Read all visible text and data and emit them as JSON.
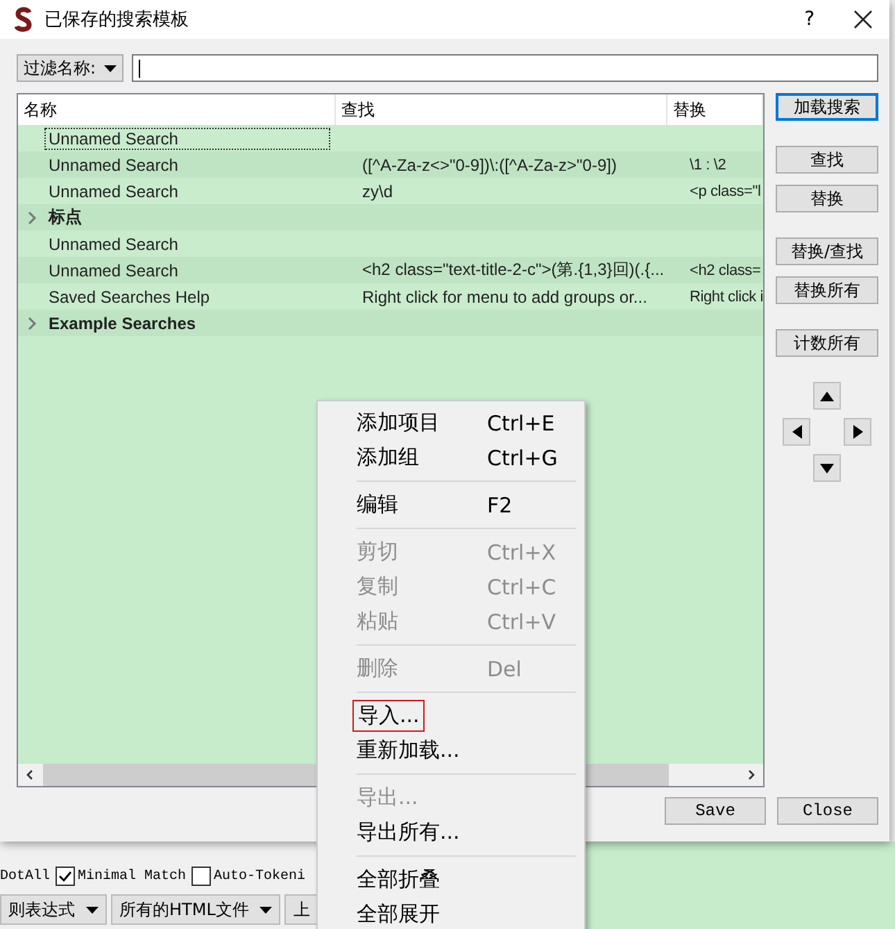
{
  "window": {
    "title": "已保存的搜索模板",
    "help": "?"
  },
  "filter": {
    "label": "过滤名称:"
  },
  "table": {
    "columns": [
      "名称",
      "查找",
      "替换"
    ],
    "rows": [
      {
        "kind": "item",
        "name": "Unnamed Search",
        "find": "",
        "replace": "",
        "focused": true
      },
      {
        "kind": "item",
        "name": "Unnamed Search",
        "find": "([^A-Za-z<>\"0-9])\\:([^A-Za-z>\"0-9])",
        "replace": "\\1 : \\2",
        "focused": false
      },
      {
        "kind": "item",
        "name": "Unnamed Search",
        "find": "zy\\d",
        "replace": "<p class=\"l",
        "focused": false
      },
      {
        "kind": "group",
        "name": "标点",
        "expanded": false
      },
      {
        "kind": "item",
        "name": "Unnamed Search",
        "find": "",
        "replace": "",
        "focused": false
      },
      {
        "kind": "item",
        "name": "Unnamed Search",
        "find": "<h2 class=\"text-title-2-c\">(第.{1,3}回)(.{...",
        "replace": "<h2 class=",
        "focused": false
      },
      {
        "kind": "item",
        "name": "Saved Searches Help",
        "find": "Right click for menu to add groups or...",
        "replace": "Right click i",
        "focused": false
      },
      {
        "kind": "group",
        "name": "Example Searches",
        "expanded": false
      }
    ]
  },
  "side_buttons": [
    [
      {
        "label": "加载搜索",
        "default": true
      }
    ],
    [
      {
        "label": "查找",
        "default": false
      },
      {
        "label": "替换",
        "default": false
      }
    ],
    [
      {
        "label": "替换/查找",
        "default": false
      },
      {
        "label": "替换所有",
        "default": false
      }
    ],
    [
      {
        "label": "计数所有",
        "default": false
      }
    ]
  ],
  "footer_buttons": [
    "Save",
    "Close"
  ],
  "context_menu": [
    {
      "kind": "item",
      "label": "添加项目",
      "shortcut": "Ctrl+E",
      "disabled": false,
      "marked": false
    },
    {
      "kind": "item",
      "label": "添加组",
      "shortcut": "Ctrl+G",
      "disabled": false,
      "marked": false
    },
    {
      "kind": "separator"
    },
    {
      "kind": "item",
      "label": "编辑",
      "shortcut": "F2",
      "disabled": false,
      "marked": false
    },
    {
      "kind": "separator"
    },
    {
      "kind": "item",
      "label": "剪切",
      "shortcut": "Ctrl+X",
      "disabled": true,
      "marked": false
    },
    {
      "kind": "item",
      "label": "复制",
      "shortcut": "Ctrl+C",
      "disabled": true,
      "marked": false
    },
    {
      "kind": "item",
      "label": "粘贴",
      "shortcut": "Ctrl+V",
      "disabled": true,
      "marked": false
    },
    {
      "kind": "separator"
    },
    {
      "kind": "item",
      "label": "删除",
      "shortcut": "Del",
      "disabled": true,
      "marked": false
    },
    {
      "kind": "separator"
    },
    {
      "kind": "item",
      "label": "导入...",
      "disabled": false,
      "marked": true
    },
    {
      "kind": "item",
      "label": "重新加载...",
      "disabled": false,
      "marked": false
    },
    {
      "kind": "separator"
    },
    {
      "kind": "item",
      "label": "导出...",
      "disabled": true,
      "marked": false
    },
    {
      "kind": "item",
      "label": "导出所有...",
      "disabled": false,
      "marked": false
    },
    {
      "kind": "separator"
    },
    {
      "kind": "item",
      "label": "全部折叠",
      "disabled": false,
      "marked": false
    },
    {
      "kind": "item",
      "label": "全部展开",
      "disabled": false,
      "marked": false
    }
  ],
  "background_app": {
    "options_label": "DotAll",
    "checkboxes": [
      {
        "label": "Minimal Match",
        "checked": true
      },
      {
        "label": "Auto-Tokeni",
        "checked": false
      }
    ],
    "dropdowns": [
      "则表达式",
      "所有的HTML文件",
      "上"
    ]
  }
}
